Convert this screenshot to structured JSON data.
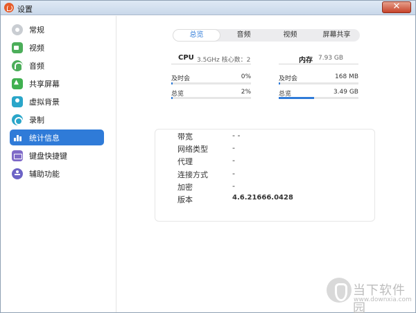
{
  "window": {
    "title": "设置",
    "close_symbol": "✕"
  },
  "sidebar": {
    "items": [
      {
        "label": "常规",
        "icon": "gear-icon"
      },
      {
        "label": "视频",
        "icon": "video-icon"
      },
      {
        "label": "音频",
        "icon": "headphones-icon"
      },
      {
        "label": "共享屏幕",
        "icon": "share-screen-icon"
      },
      {
        "label": "虚拟背景",
        "icon": "virtual-background-icon"
      },
      {
        "label": "录制",
        "icon": "record-icon"
      },
      {
        "label": "统计信息",
        "icon": "stats-icon",
        "active": true
      },
      {
        "label": "键盘快捷键",
        "icon": "keyboard-icon"
      },
      {
        "label": "辅助功能",
        "icon": "accessibility-icon"
      }
    ]
  },
  "tabs": [
    {
      "label": "总览",
      "active": true
    },
    {
      "label": "音频"
    },
    {
      "label": "视频"
    },
    {
      "label": "屏幕共享"
    }
  ],
  "cpu": {
    "label": "CPU",
    "detail": "3.5GHz  核心数：2",
    "current_label": "及时会",
    "current_value": "0%",
    "current_fraction": 0.0,
    "total_label": "总览",
    "total_value": "2%",
    "total_fraction": 0.02
  },
  "memory": {
    "label": "内存",
    "detail": "7.93 GB",
    "current_label": "及时会",
    "current_value": "168 MB",
    "current_fraction": 0.02,
    "total_label": "总览",
    "total_value": "3.49 GB",
    "total_fraction": 0.44
  },
  "info": {
    "rows": [
      {
        "key": "带宽",
        "value": "-  -"
      },
      {
        "key": "网络类型",
        "value": "-"
      },
      {
        "key": "代理",
        "value": "-"
      },
      {
        "key": "连接方式",
        "value": "-"
      },
      {
        "key": "加密",
        "value": "-"
      },
      {
        "key": "版本",
        "value": "4.6.21666.0428"
      }
    ]
  },
  "watermark": {
    "text": "当下软件园",
    "url": "www.downxia.com"
  },
  "colors": {
    "accent": "#2f7bd8",
    "titlebar": "#c9d8ea",
    "close": "#c7432a"
  }
}
